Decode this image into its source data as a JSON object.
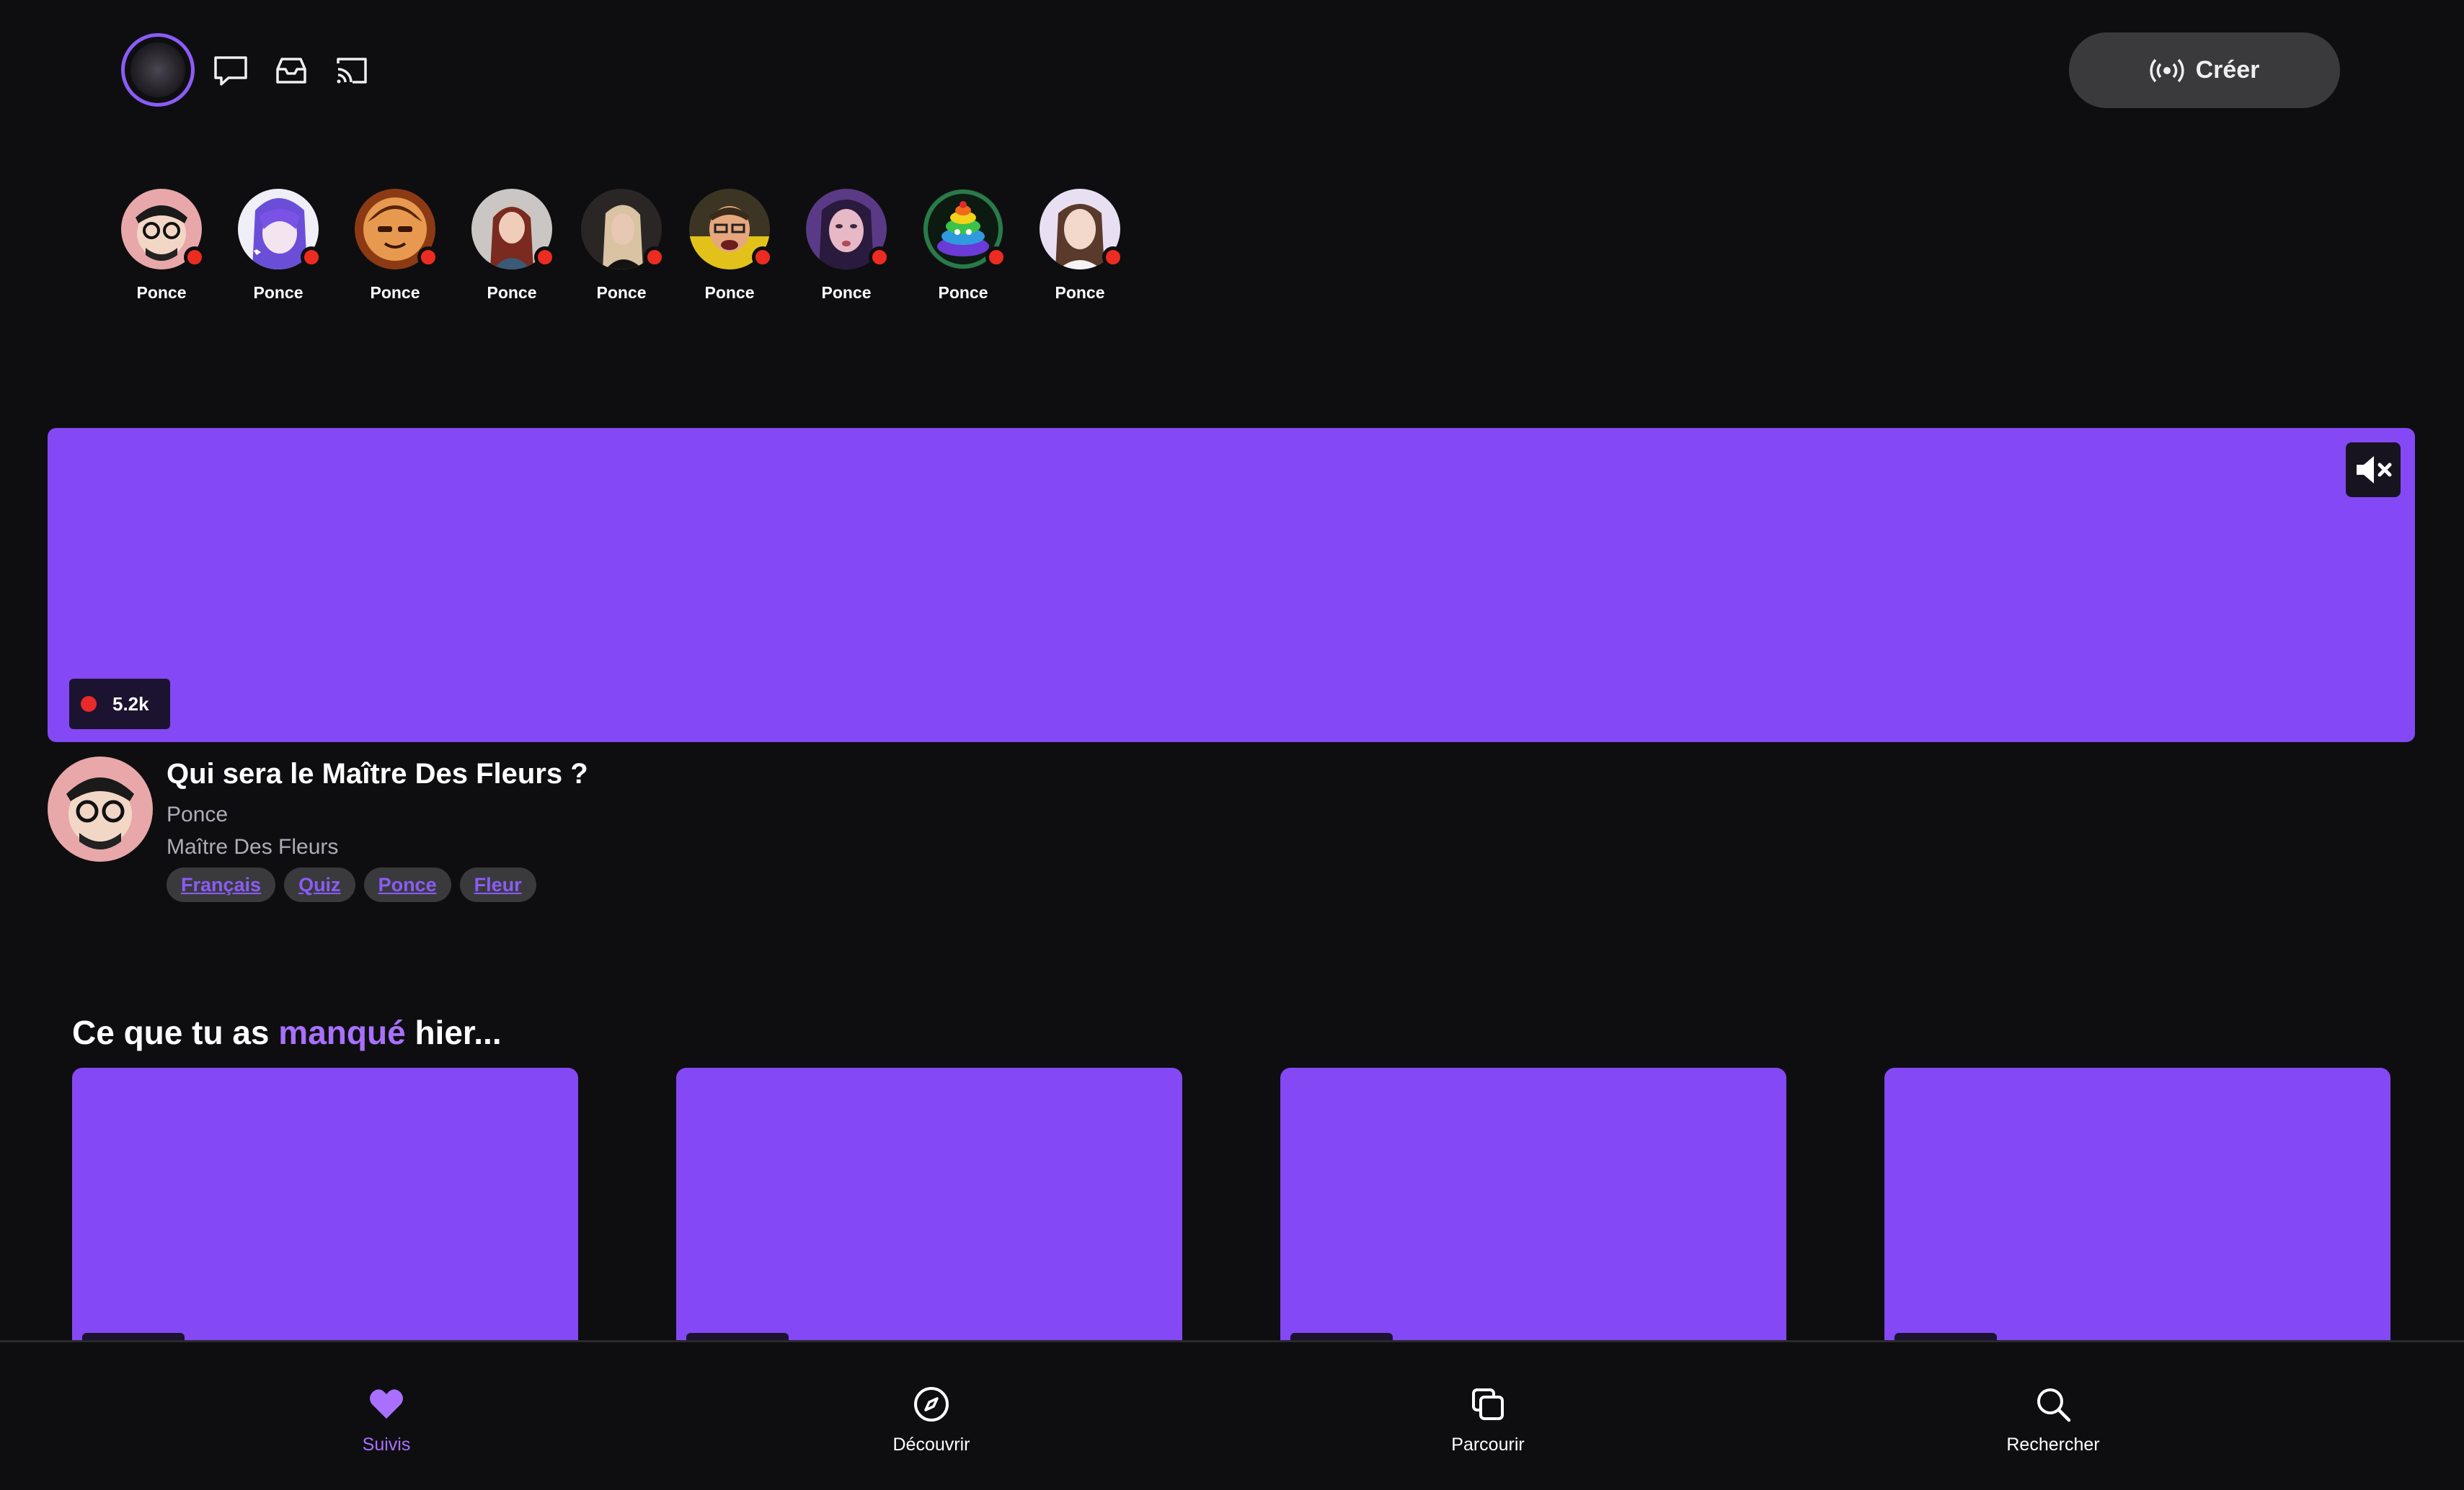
{
  "topbar": {
    "create_label": "Créer",
    "icons": [
      "chat-icon",
      "inbox-icon",
      "cast-icon"
    ]
  },
  "stories": [
    {
      "name": "Ponce",
      "avatar": "bearded-glasses"
    },
    {
      "name": "Ponce",
      "avatar": "anime-purple"
    },
    {
      "name": "Ponce",
      "avatar": "orange-cartoon"
    },
    {
      "name": "Ponce",
      "avatar": "woman-redhair"
    },
    {
      "name": "Ponce",
      "avatar": "woman-dark"
    },
    {
      "name": "Ponce",
      "avatar": "man-yellow"
    },
    {
      "name": "Ponce",
      "avatar": "woman-purple"
    },
    {
      "name": "Ponce",
      "avatar": "rainbow-poop"
    },
    {
      "name": "Ponce",
      "avatar": "woman-light"
    }
  ],
  "featured": {
    "viewers": "5.2k",
    "title": "Qui sera le Maître Des Fleurs ?",
    "streamer": "Ponce",
    "category": "Maître Des Fleurs",
    "tags": [
      "Français",
      "Quiz",
      "Ponce",
      "Fleur"
    ]
  },
  "section": {
    "title_before": "Ce que tu as ",
    "title_accent": "manqué",
    "title_after": " hier..."
  },
  "bottom_nav": [
    {
      "label": "Suivis",
      "icon": "heart-icon",
      "active": true
    },
    {
      "label": "Découvrir",
      "icon": "compass-icon",
      "active": false
    },
    {
      "label": "Parcourir",
      "icon": "browse-icon",
      "active": false
    },
    {
      "label": "Rechercher",
      "icon": "search-icon",
      "active": false
    }
  ],
  "colors": {
    "accent": "#8b5cf6",
    "player": "#8448f4",
    "live": "#e82a2a",
    "background": "#0e0e10"
  }
}
